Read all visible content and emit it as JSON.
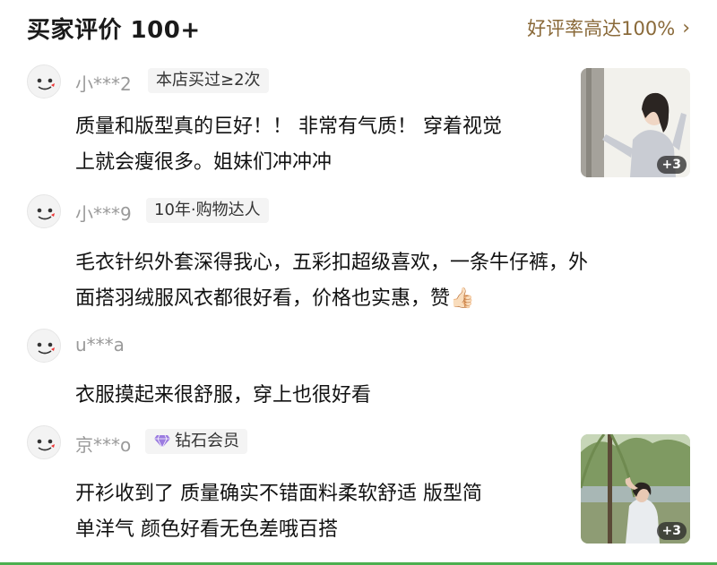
{
  "header": {
    "title": "买家评价 100+",
    "rate": "好评率高达100%",
    "chevron": "›"
  },
  "reviews": [
    {
      "user": "小***2",
      "badge": "本店买过≥2次",
      "lines": [
        "质量和版型真的巨好！！ 非常有气质！ 穿着视觉",
        "上就会瘦很多。姐妹们冲冲冲"
      ],
      "image_count": "+3"
    },
    {
      "user": "小***9",
      "badge": "10年·购物达人",
      "lines": [
        "毛衣针织外套深得我心，五彩扣超级喜欢，一条牛仔裤，外",
        "面搭羽绒服风衣都很好看，价格也实惠，赞👍🏻"
      ]
    },
    {
      "user": "u***a",
      "lines": [
        "衣服摸起来很舒服，穿上也很好看"
      ]
    },
    {
      "user": "京***o",
      "badge": "钻石会员",
      "badge_icon": "diamond-icon",
      "lines": [
        "开衫收到了 质量确实不错面料柔软舒适 版型简",
        "单洋气 颜色好看无色差哦百搭"
      ],
      "image_count": "+3"
    }
  ],
  "colors": {
    "accent": "#8a6a3a",
    "badge_bg": "#f4f4f4",
    "username": "#9a9a9a",
    "diamond": "#9b7be0"
  }
}
